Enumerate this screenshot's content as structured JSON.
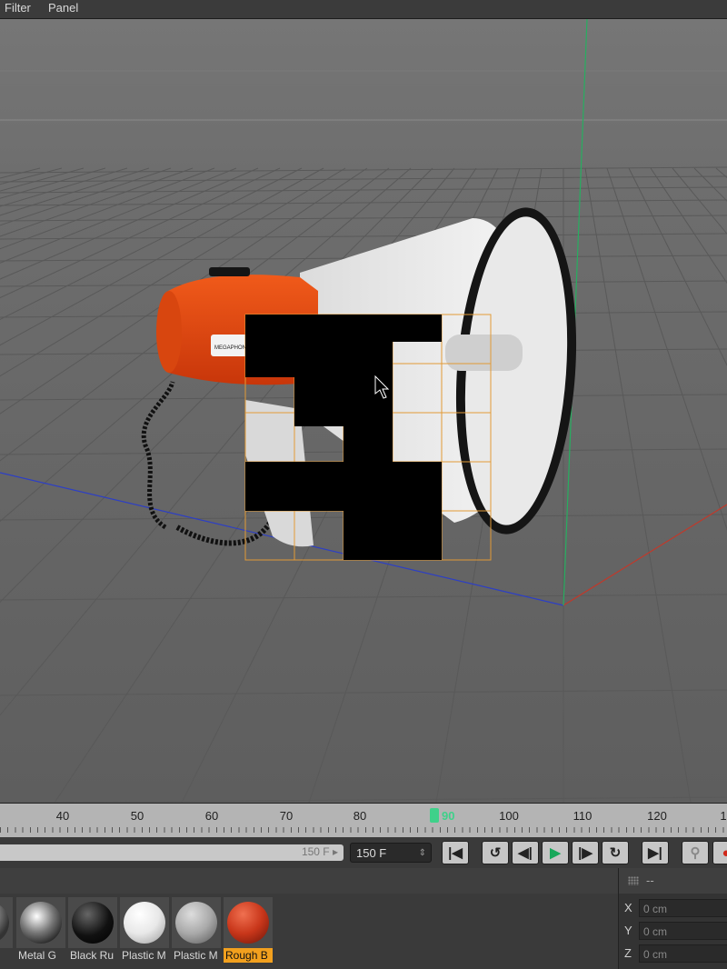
{
  "menu": {
    "items": [
      "Filter",
      "Panel"
    ]
  },
  "viewport": {
    "object": "megaphone",
    "label_text": "MEGAPHONE"
  },
  "timeline": {
    "ticks": [
      "40",
      "50",
      "60",
      "70",
      "80",
      "90",
      "100",
      "110",
      "120",
      "1"
    ],
    "current_frame": "90"
  },
  "transport": {
    "range_end": "150 F ▸",
    "frame_field": "150 F",
    "frame_spinner": "⇕",
    "buttons": {
      "go_start": "|◀",
      "loop": "↺",
      "step_back": "◀|",
      "play": "▶",
      "step_forward": "|▶",
      "record_cycle": "↻",
      "go_end": "▶|",
      "key": "⚲",
      "record": "●"
    }
  },
  "materials": [
    {
      "name": "Metal G",
      "color": "#9a9a9a",
      "selected": false
    },
    {
      "name": "Black Ru",
      "color": "#111111",
      "selected": false
    },
    {
      "name": "Plastic M",
      "color": "#e8e8e8",
      "selected": false
    },
    {
      "name": "Plastic M",
      "color": "#a9a9a9",
      "selected": false
    },
    {
      "name": "Rough B",
      "color": "#c8361a",
      "selected": true
    }
  ],
  "coordinates": {
    "header": "--",
    "rows": [
      {
        "axis": "X",
        "value": "0 cm"
      },
      {
        "axis": "Y",
        "value": "0 cm"
      },
      {
        "axis": "Z",
        "value": "0 cm"
      }
    ]
  },
  "colors": {
    "accent": "#f2a01e",
    "playhead": "#3fd18a",
    "megaphone_body": "#e8490d",
    "axis_x": "#c0392b",
    "axis_y": "#27ae60",
    "axis_z": "#2d3fc4"
  }
}
